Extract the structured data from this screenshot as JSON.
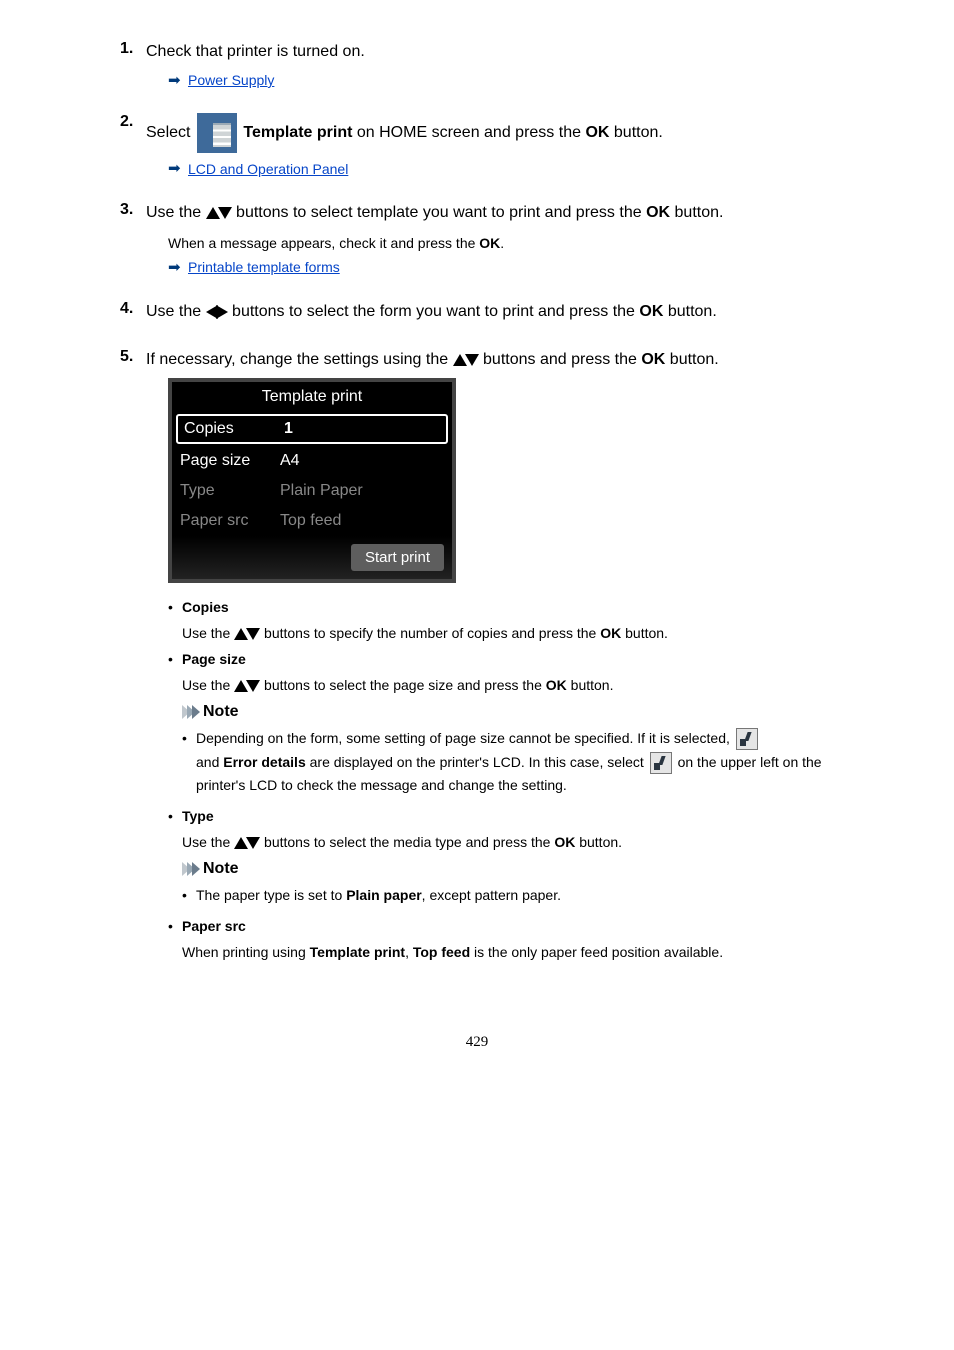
{
  "steps": {
    "s1": {
      "text_before": "Check that printer is turned on.",
      "link": "Power Supply"
    },
    "s2": {
      "pre": "Select ",
      "bold": "Template print",
      "post": " on HOME screen and press the ",
      "ok": "OK",
      "post2": " button.",
      "link": "LCD and Operation Panel"
    },
    "s3": {
      "pre": "Use the ",
      "post": " buttons to select template you want to print and press the ",
      "ok": "OK",
      "post2": " button.",
      "sub": "When a message appears, check it and press the ",
      "sub_ok": "OK",
      "sub_post": ".",
      "link": "Printable template forms"
    },
    "s4": {
      "pre": "Use the ",
      "post": " buttons to select the form you want to print and press the ",
      "ok": "OK",
      "post2": " button."
    },
    "s5": {
      "pre": "If necessary, change the settings using the ",
      "post": " buttons and press the ",
      "ok": "OK",
      "post2": " button."
    }
  },
  "lcd": {
    "title": "Template print",
    "rows": [
      {
        "label": "Copies",
        "value": "1",
        "selected": true,
        "dim": false
      },
      {
        "label": "Page size",
        "value": "A4",
        "selected": false,
        "dim": false
      },
      {
        "label": "Type",
        "value": "Plain Paper",
        "selected": false,
        "dim": true
      },
      {
        "label": "Paper src",
        "value": "Top feed",
        "selected": false,
        "dim": true
      }
    ],
    "start": "Start print"
  },
  "settings": {
    "copies": {
      "title": "Copies",
      "body_pre": "Use the ",
      "body_post": " buttons to specify the number of copies and press the ",
      "ok": "OK",
      "body_post2": " button."
    },
    "page_size": {
      "title": "Page size",
      "body_pre": "Use the ",
      "body_post": " buttons to select the page size and press the ",
      "ok": "OK",
      "body_post2": " button.",
      "note_label": "Note",
      "note1_pre": "Depending on the form, some setting of page size cannot be specified. If it is selected, ",
      "note1_mid1": "and ",
      "note1_bold": "Error details",
      "note1_mid2": " are displayed on the printer's LCD. In this case, select ",
      "note1_post": " on the upper left on the printer's LCD to check the message and change the setting."
    },
    "type": {
      "title": "Type",
      "body_pre": "Use the ",
      "body_post": " buttons to select the media type and press the ",
      "ok": "OK",
      "body_post2": " button.",
      "note_label": "Note",
      "note1_pre": "The paper type is set to ",
      "note1_bold": "Plain paper",
      "note1_post": ", except pattern paper."
    },
    "paper_src": {
      "title": "Paper src",
      "body_pre": "When printing using ",
      "body_bold1": "Template print",
      "body_mid": ", ",
      "body_bold2": "Top feed",
      "body_post": " is the only paper feed position available."
    }
  },
  "page_number": "429"
}
